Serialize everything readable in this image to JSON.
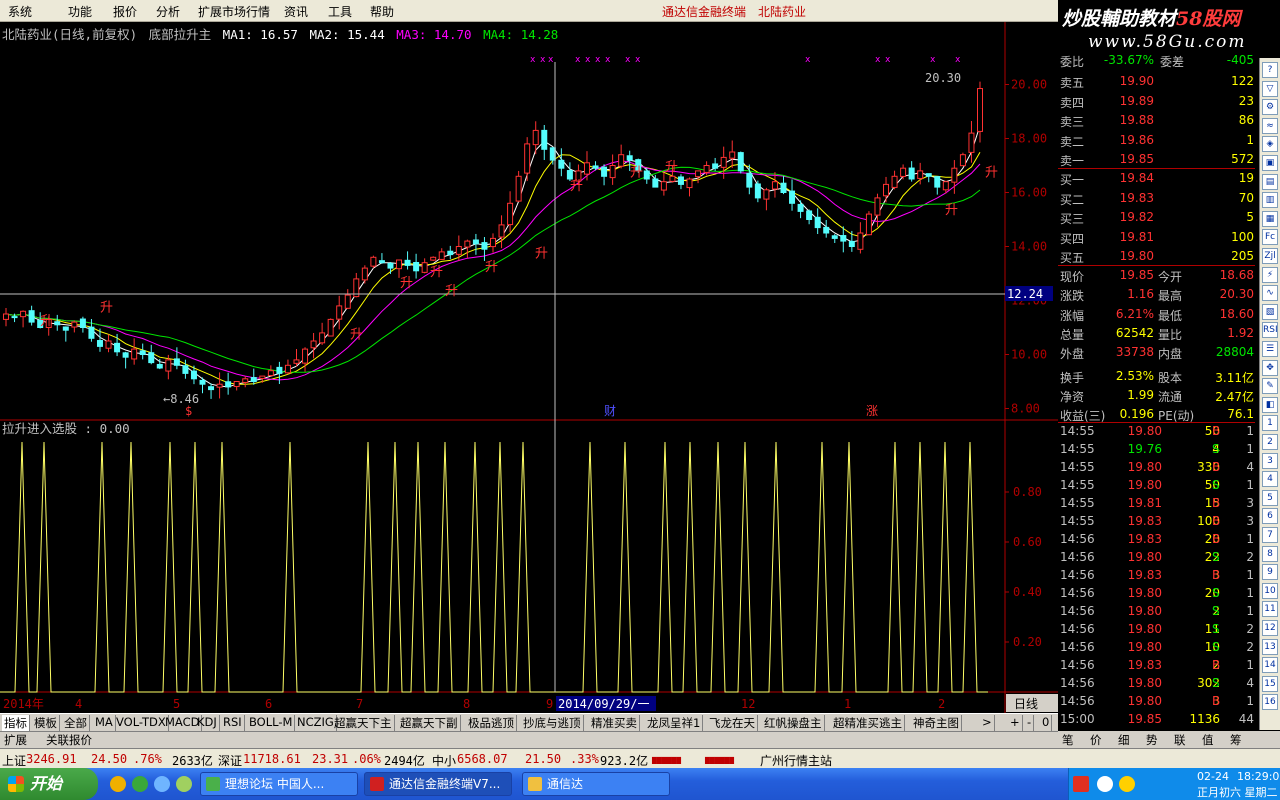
{
  "menu": {
    "items": [
      "系统",
      "功能",
      "报价",
      "分析",
      "扩展市场行情",
      "资讯",
      "工具",
      "帮助"
    ],
    "title1": "通达信金融终端",
    "title2": "北陆药业"
  },
  "watermark": {
    "line1a": "炒股輔助教材",
    "line1b": "58股网",
    "line2": "www.58Gu.com"
  },
  "header": {
    "stock": "北陆药业",
    "period": "(日线,前复权)",
    "indicator": "底部拉升主",
    "ma1": "MA1: 16.57",
    "ma2": "MA2: 15.44",
    "ma3": "MA3: 14.70",
    "ma4": "MA4: 14.28"
  },
  "colors": {
    "up": "#ff3232",
    "down": "#54fcfc",
    "ma1": "#ffffff",
    "ma2": "#ffff00",
    "ma3": "#ff00ff",
    "ma4": "#00e600",
    "grid": "#800000",
    "axis": "#b00000"
  },
  "chart_data": [
    {
      "type": "candlestick",
      "title": "北陆药业(日线,前复权)",
      "ylim": [
        7.5,
        21.5
      ],
      "yticks": [
        "20.00",
        "18.00",
        "16.00",
        "14.00",
        "12.00",
        "10.00",
        "8.00"
      ],
      "annotations": {
        "high": "20.30",
        "low": "8.46",
        "cursor_price": "12.24",
        "signal": "升"
      },
      "markers": [
        "$",
        "财",
        "涨"
      ],
      "closes": [
        11.5,
        11.4,
        11.6,
        11.2,
        11.0,
        11.3,
        11.1,
        10.9,
        11.2,
        11.0,
        10.6,
        10.3,
        10.5,
        10.1,
        9.9,
        10.2,
        10.0,
        9.7,
        9.5,
        9.8,
        9.6,
        9.3,
        9.1,
        8.9,
        8.7,
        8.9,
        8.8,
        9.0,
        9.1,
        9.0,
        9.2,
        9.4,
        9.3,
        9.6,
        9.8,
        10.2,
        10.5,
        10.8,
        11.3,
        11.8,
        12.2,
        12.8,
        13.2,
        13.6,
        13.4,
        13.2,
        13.5,
        13.3,
        13.1,
        13.4,
        13.6,
        13.8,
        13.7,
        14.0,
        14.2,
        14.1,
        13.9,
        14.3,
        14.8,
        15.6,
        16.6,
        17.8,
        18.3,
        17.6,
        17.2,
        16.9,
        16.5,
        16.8,
        17.1,
        16.9,
        16.6,
        17.0,
        17.4,
        17.2,
        16.8,
        16.5,
        16.2,
        16.4,
        16.6,
        16.3,
        16.5,
        16.8,
        17.0,
        16.9,
        17.3,
        17.5,
        16.8,
        16.2,
        15.8,
        16.1,
        16.4,
        16.0,
        15.6,
        15.3,
        15.0,
        14.7,
        14.5,
        14.3,
        14.2,
        14.0,
        14.5,
        15.2,
        15.8,
        16.3,
        16.6,
        16.9,
        16.5,
        16.8,
        16.6,
        16.2,
        16.4,
        16.9,
        17.4,
        18.2,
        19.85
      ]
    },
    {
      "type": "line",
      "title": "拉升进入选股",
      "value": "0.00",
      "yticks": [
        "0.80",
        "0.60",
        "0.40",
        "0.20"
      ],
      "ylim": [
        0,
        1
      ],
      "xticks": [
        "2014年",
        "4",
        "5",
        "6",
        "7",
        "8",
        "9",
        "2014/09/29/一",
        "12",
        "1",
        "2",
        "日线"
      ]
    }
  ],
  "quote": {
    "top": {
      "l1": "委比",
      "v1": "-33.67%",
      "l2": "委差",
      "v2": "-405"
    },
    "sell": [
      {
        "l": "卖五",
        "p": "19.90",
        "v": "122"
      },
      {
        "l": "卖四",
        "p": "19.89",
        "v": "23"
      },
      {
        "l": "卖三",
        "p": "19.88",
        "v": "86"
      },
      {
        "l": "卖二",
        "p": "19.86",
        "v": "1"
      },
      {
        "l": "卖一",
        "p": "19.85",
        "v": "572"
      }
    ],
    "buy": [
      {
        "l": "买一",
        "p": "19.84",
        "v": "19"
      },
      {
        "l": "买二",
        "p": "19.83",
        "v": "70"
      },
      {
        "l": "买三",
        "p": "19.82",
        "v": "5"
      },
      {
        "l": "买四",
        "p": "19.81",
        "v": "100"
      },
      {
        "l": "买五",
        "p": "19.80",
        "v": "205"
      }
    ],
    "stats": [
      {
        "l1": "现价",
        "v1": "19.85",
        "c1": "#ff3232",
        "l2": "今开",
        "v2": "18.68",
        "c2": "#ff3232"
      },
      {
        "l1": "涨跌",
        "v1": "1.16",
        "c1": "#ff3232",
        "l2": "最高",
        "v2": "20.30",
        "c2": "#ff3232"
      },
      {
        "l1": "涨幅",
        "v1": "6.21%",
        "c1": "#ff3232",
        "l2": "最低",
        "v2": "18.60",
        "c2": "#ff3232"
      },
      {
        "l1": "总量",
        "v1": "62542",
        "c1": "#ffff00",
        "l2": "量比",
        "v2": "1.92",
        "c2": "#ff3232"
      },
      {
        "l1": "外盘",
        "v1": "33738",
        "c1": "#ff3232",
        "l2": "内盘",
        "v2": "28804",
        "c2": "#00e600"
      },
      {
        "l1": "换手",
        "v1": "2.53%",
        "c1": "#ffff00",
        "l2": "股本",
        "v2": "3.11亿",
        "c2": "#ffff00"
      },
      {
        "l1": "净资",
        "v1": "1.99",
        "c1": "#ffff00",
        "l2": "流通",
        "v2": "2.47亿",
        "c2": "#ffff00"
      },
      {
        "l1": "收益(三)",
        "v1": "0.196",
        "c1": "#ffff00",
        "l2": "PE(动)",
        "v2": "76.1",
        "c2": "#ffff00"
      }
    ],
    "ticks": [
      {
        "t": "14:55",
        "p": "19.80",
        "v": "50",
        "bs": "B",
        "n": "1"
      },
      {
        "t": "14:55",
        "p": "19.76",
        "v": "4",
        "bs": "S",
        "n": "1"
      },
      {
        "t": "14:55",
        "p": "19.80",
        "v": "330",
        "bs": "B",
        "n": "4"
      },
      {
        "t": "14:55",
        "p": "19.80",
        "v": "50",
        "bs": "S",
        "n": "1"
      },
      {
        "t": "14:55",
        "p": "19.81",
        "v": "15",
        "bs": "B",
        "n": "3"
      },
      {
        "t": "14:55",
        "p": "19.83",
        "v": "100",
        "bs": "B",
        "n": "3"
      },
      {
        "t": "14:56",
        "p": "19.83",
        "v": "20",
        "bs": "B",
        "n": "1"
      },
      {
        "t": "14:56",
        "p": "19.80",
        "v": "22",
        "bs": "S",
        "n": "2"
      },
      {
        "t": "14:56",
        "p": "19.83",
        "v": "3",
        "bs": "B",
        "n": "1"
      },
      {
        "t": "14:56",
        "p": "19.80",
        "v": "20",
        "bs": "S",
        "n": "1"
      },
      {
        "t": "14:56",
        "p": "19.80",
        "v": "2",
        "bs": "S",
        "n": "1"
      },
      {
        "t": "14:56",
        "p": "19.80",
        "v": "11",
        "bs": "S",
        "n": "2"
      },
      {
        "t": "14:56",
        "p": "19.80",
        "v": "10",
        "bs": "S",
        "n": "2"
      },
      {
        "t": "14:56",
        "p": "19.83",
        "v": "2",
        "bs": "B",
        "n": "1"
      },
      {
        "t": "14:56",
        "p": "19.80",
        "v": "302",
        "bs": "S",
        "n": "4"
      },
      {
        "t": "14:56",
        "p": "19.80",
        "v": "3",
        "bs": "B",
        "n": "1"
      },
      {
        "t": "15:00",
        "p": "19.85",
        "v": "1136",
        "bs": "",
        "n": "44"
      }
    ]
  },
  "tabs": [
    "指标",
    "模板",
    "全部",
    "MA",
    "VOL-TDX",
    "MACD",
    "KDJ",
    "RSI",
    "BOLL-M",
    "NCZIG",
    "超赢天下主",
    "超赢天下副",
    "极品逃顶",
    "抄底与逃顶",
    "精准买卖",
    "龙凤呈祥1",
    "飞龙在天",
    "红帆操盘主",
    "超精准买逃主",
    "神奇主图",
    ">",
    "+",
    "-",
    "0"
  ],
  "subtabs": [
    "扩展",
    "关联报价"
  ],
  "rtabs": [
    "笔",
    "价",
    "细",
    "势",
    "联",
    "值",
    "筹"
  ],
  "status": {
    "sh_label": "上证",
    "sh_val": "3246.91",
    "sh_chg": "24.50",
    "sh_pct": ".76%",
    "sh_amt": "2633亿",
    "sz_label": "深证",
    "sz_val": "11718.61",
    "sz_chg": "23.31",
    "sz_pct": ".06%",
    "sz_amt": "2494亿",
    "zx_label": "中小",
    "zx_val": "6568.07",
    "zx_chg": "21.50",
    "zx_pct": ".33%",
    "zx_amt": "923.2亿",
    "bar1": "▆▆▆▆▆▆",
    "bar2": "▆▆▆▆▆▆",
    "station": "广州行情主站"
  },
  "taskbar": {
    "start": "开始",
    "tasks": [
      "理想论坛 中国人...",
      "通达信金融终端V7...",
      "通信达"
    ],
    "date": "02-24",
    "time": "18:29:03",
    "lunar": "正月初六 星期二"
  },
  "righttools": [
    "?",
    "▽",
    "⚙",
    "≈",
    "◈",
    "▣",
    "▤",
    "▥",
    "▦",
    "Fc",
    "Zjl",
    "⚡",
    "∿",
    "▧",
    "RSI",
    "☰",
    "✥",
    "✎",
    "◧",
    "1",
    "2",
    "3",
    "4",
    "5",
    "6",
    "7",
    "8",
    "9",
    "10",
    "11",
    "12",
    "13",
    "14",
    "15",
    "16"
  ],
  "scroll_label": "日线"
}
